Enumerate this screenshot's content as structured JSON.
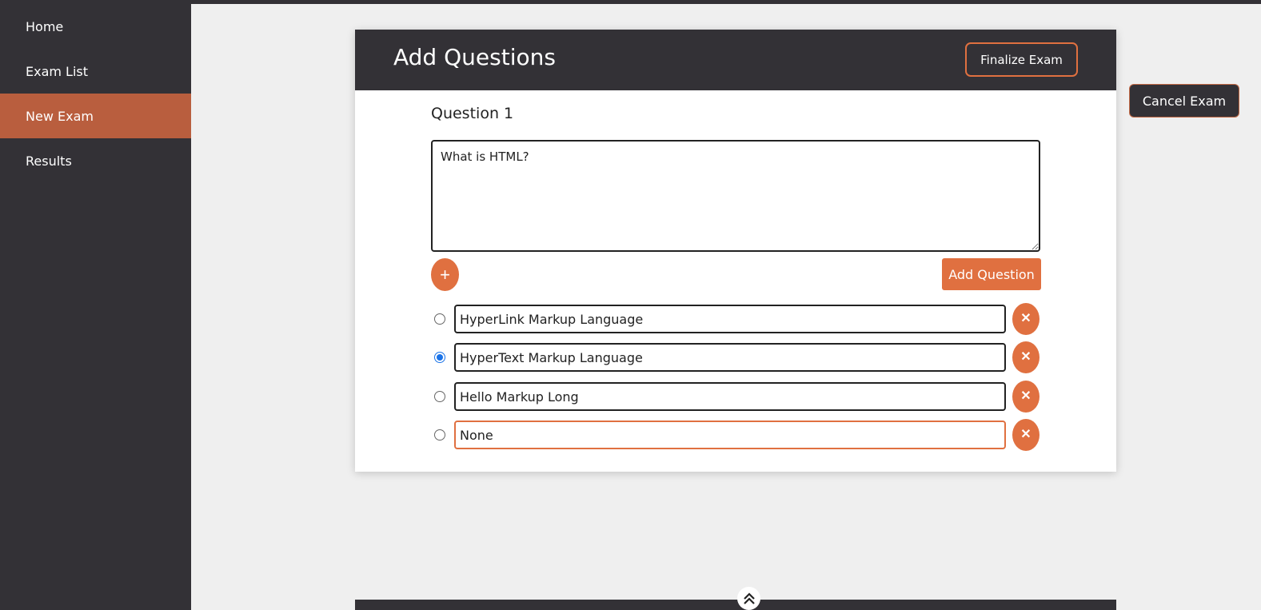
{
  "sidebar": {
    "items": [
      {
        "label": "Home",
        "active": false
      },
      {
        "label": "Exam List",
        "active": false
      },
      {
        "label": "New Exam",
        "active": true
      },
      {
        "label": "Results",
        "active": false
      }
    ]
  },
  "header": {
    "title": "Add Questions",
    "finalize_label": "Finalize Exam"
  },
  "cancel_label": "Cancel Exam",
  "question": {
    "label": "Question 1",
    "text": "What is HTML?",
    "add_option_symbol": "+",
    "add_question_label": "Add Question",
    "options": [
      {
        "value": "HyperLink Markup Language",
        "selected": false
      },
      {
        "value": "HyperText Markup Language",
        "selected": true
      },
      {
        "value": "Hello Markup Long",
        "selected": false
      },
      {
        "value": "None",
        "selected": false
      }
    ],
    "delete_symbol": "✕"
  },
  "colors": {
    "dark": "#333136",
    "accent": "#e07040",
    "active_nav": "#b95e3e",
    "background": "#efefef"
  },
  "icons": {
    "scroll_top": "double-chevron-up-icon",
    "delete_option": "close-icon",
    "add_option": "plus-icon"
  }
}
